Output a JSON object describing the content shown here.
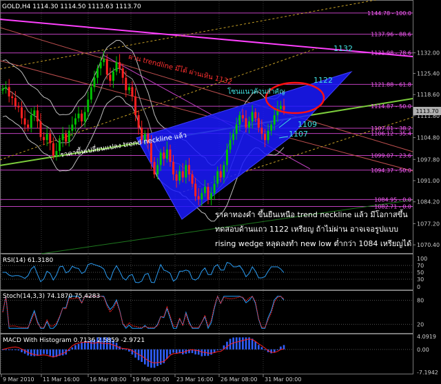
{
  "header": {
    "title": "GOLD,H4  1114.30  1114.50  1113.63  1113.70"
  },
  "price_axis": {
    "ticks": [
      "1132.00",
      "1125.40",
      "1118.60",
      "1111.80",
      "1104.80",
      "1097.80",
      "1091.00",
      "1084.20",
      "1077.20",
      "1070.40"
    ],
    "current": "1113.70"
  },
  "fib_levels": [
    {
      "label": "1144.78 - 100.0",
      "price": 1144.78
    },
    {
      "label": "1137.96 - 88.6",
      "price": 1137.96
    },
    {
      "label": "1131.98 - 78.6",
      "price": 1131.98
    },
    {
      "label": "1121.88 - 61.8",
      "price": 1121.88
    },
    {
      "label": "1114.87 - 50.0",
      "price": 1114.87
    },
    {
      "label": "1107.81 - 38.2",
      "price": 1107.81
    },
    {
      "label": "1106.12 - 35.4",
      "price": 1106.12
    },
    {
      "label": "1099.07 - 23.6",
      "price": 1099.07
    },
    {
      "label": "1094.37 - 50.0",
      "price": 1094.37
    },
    {
      "label": "1084.95 - 0.0",
      "price": 1084.95
    },
    {
      "label": "1082.71 - 0.0",
      "price": 1082.71
    }
  ],
  "annotations": {
    "trendline_break": "ผ่าน trendline มีได้ ผ่านเหิน 1132",
    "resistance": "โซนแนวต้านสำคัญ",
    "neckline": "ราคาขึ้นเปลี่ยนแปลง trend neckline แล้ว",
    "level_1132": "1132",
    "level_1122": "1122",
    "level_1109": "1109",
    "level_1107": "1107",
    "note": [
      "ราคาทองคำ ขึ้นยืนเหนือ trend neckline แล้ว มีโอกาสขึ้น",
      "ทดสอบด้านแถว 1122 เหรียญ ถ้าไม่ผ่าน อาจเจอรูปแบบ",
      "rising wedge หลุดลงทำ new low ต่ำกว่า 1084 เหรียญได้"
    ]
  },
  "time_axis": {
    "labels": [
      "9 Mar 2010",
      "11 Mar 16:00",
      "16 Mar 08:00",
      "19 Mar 00:00",
      "23 Mar 16:00",
      "26 Mar 08:00",
      "31 Mar 00:00"
    ]
  },
  "rsi": {
    "title": "RSI(14) 61.3180",
    "levels": [
      "70",
      "50",
      "30"
    ],
    "value": 61.318
  },
  "stoch": {
    "title": "Stoch(14,3,3) 74.1870 75.4283",
    "levels": [
      "80",
      "20"
    ],
    "main": 74.187,
    "signal": 75.4283
  },
  "macd": {
    "title": "MACD With Histogram 0.7136 2.5859 -2.9721",
    "ticks": [
      "4.0919",
      "0.00",
      "-7.1942"
    ]
  },
  "colors": {
    "bull": "#00c000",
    "bear": "#ff2020",
    "fib": "#c040c0",
    "wedge": "#1a1aff",
    "neckline": "#7ccd3c",
    "magenta_trend": "#ff40ff",
    "cyan_text": "#40e0e0",
    "band": "#c0c0c0"
  },
  "chart_data": {
    "type": "candlestick",
    "symbol": "GOLD",
    "timeframe": "H4",
    "last": {
      "open": 1114.3,
      "high": 1114.5,
      "low": 1113.63,
      "close": 1113.7
    },
    "ylim": [
      1068.0,
      1148.5
    ],
    "close_series": [
      1120.5,
      1121,
      1118,
      1117.5,
      1115,
      1114.5,
      1111,
      1109,
      1108,
      1112,
      1113.5,
      1110,
      1105,
      1104,
      1106,
      1103,
      1099,
      1100.5,
      1104,
      1106,
      1103.5,
      1107,
      1109,
      1111,
      1112.5,
      1110,
      1113,
      1117,
      1121,
      1124,
      1127,
      1129,
      1130,
      1125,
      1123,
      1126,
      1129,
      1127,
      1124,
      1120,
      1121,
      1118,
      1112,
      1108,
      1104,
      1106,
      1103,
      1097,
      1093,
      1096,
      1100,
      1098,
      1101,
      1097,
      1093,
      1091,
      1094,
      1092,
      1096,
      1093,
      1090,
      1086,
      1085,
      1087,
      1089,
      1085,
      1087,
      1090,
      1094,
      1092,
      1096,
      1101,
      1104,
      1106,
      1109,
      1112,
      1111,
      1108,
      1110,
      1113,
      1111,
      1108,
      1106,
      1104,
      1107,
      1109,
      1112,
      1114,
      1115,
      1113.7
    ],
    "levels_marked": [
      1132,
      1122,
      1109,
      1107
    ]
  }
}
